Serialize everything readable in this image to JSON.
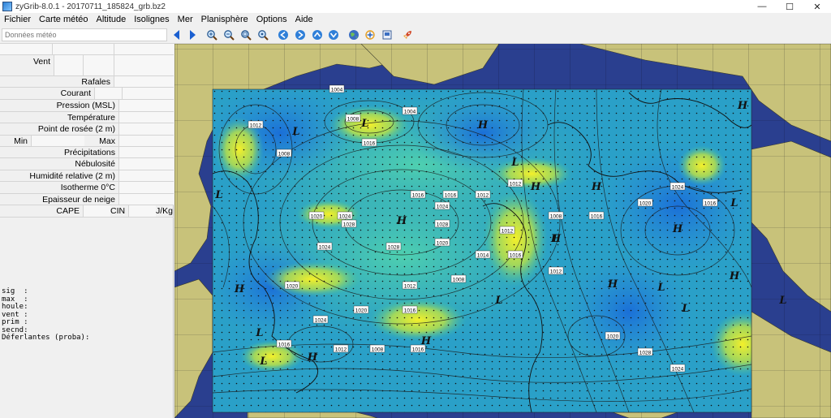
{
  "window": {
    "title": "zyGrib-8.0.1 - 20170711_185824_grb.bz2",
    "minimize": "—",
    "maximize": "☐",
    "close": "✕"
  },
  "menu": [
    "Fichier",
    "Carte météo",
    "Altitude",
    "Isolignes",
    "Mer",
    "Planisphère",
    "Options",
    "Aide"
  ],
  "search": {
    "placeholder": "Données météo"
  },
  "toolbar": {
    "icons": [
      "arrow-left-icon",
      "arrow-right-icon",
      "zoom-in-icon",
      "zoom-out-icon",
      "zoom-fit-icon",
      "zoom-reset-icon",
      "nav-back-icon",
      "nav-forward-icon",
      "nav-up-icon",
      "nav-down-icon",
      "globe-icon",
      "select-area-icon",
      "print-icon",
      "rocket-icon"
    ]
  },
  "panel": {
    "vent": "Vent",
    "rafales": "Rafales",
    "courant": "Courant",
    "pression": "Pression (MSL)",
    "temperature": "Température",
    "rosee": "Point de rosée (2 m)",
    "min": "Min",
    "max": "Max",
    "precipitations": "Précipitations",
    "nebulosite": "Nébulosité",
    "humidite": "Humidité relative (2 m)",
    "isotherme": "Isotherme 0°C",
    "neige": "Epaisseur de neige",
    "cape": "CAPE",
    "cin": "CIN",
    "jkg": "J/Kg"
  },
  "wave_info": {
    "sig": "sig  :",
    "max": "max  :",
    "houle": "houle:",
    "vent": "vent :",
    "prim": "prim :",
    "secnd": "secnd:",
    "deferlantes": "Déferlantes (proba):"
  },
  "map": {
    "colors": {
      "ocean": "#2a3f8f",
      "land": "#c8c27a",
      "field_low": "#1e7fd6",
      "field_mid": "#3fc0a0",
      "field_high": "#f2ee2a"
    },
    "pressure_labels": [
      "1004",
      "1004",
      "1008",
      "1016",
      "1012",
      "1008",
      "1020",
      "1024",
      "1028",
      "1028",
      "1024",
      "1020",
      "1016",
      "1016",
      "1012",
      "1012",
      "1024",
      "1028",
      "1020",
      "1012",
      "1008",
      "1016",
      "1020",
      "1024",
      "1016",
      "1012",
      "1016",
      "1014",
      "1008",
      "1012",
      "1016",
      "1020",
      "1024",
      "1016",
      "1012",
      "1008",
      "1016",
      "1020",
      "1028",
      "1024"
    ],
    "pressure_centers": [
      "H",
      "H",
      "H",
      "H",
      "H",
      "H",
      "H",
      "H",
      "H",
      "H",
      "H",
      "H",
      "L",
      "L",
      "L",
      "L",
      "L",
      "L",
      "L",
      "L",
      "L",
      "L",
      "L",
      "L"
    ]
  }
}
